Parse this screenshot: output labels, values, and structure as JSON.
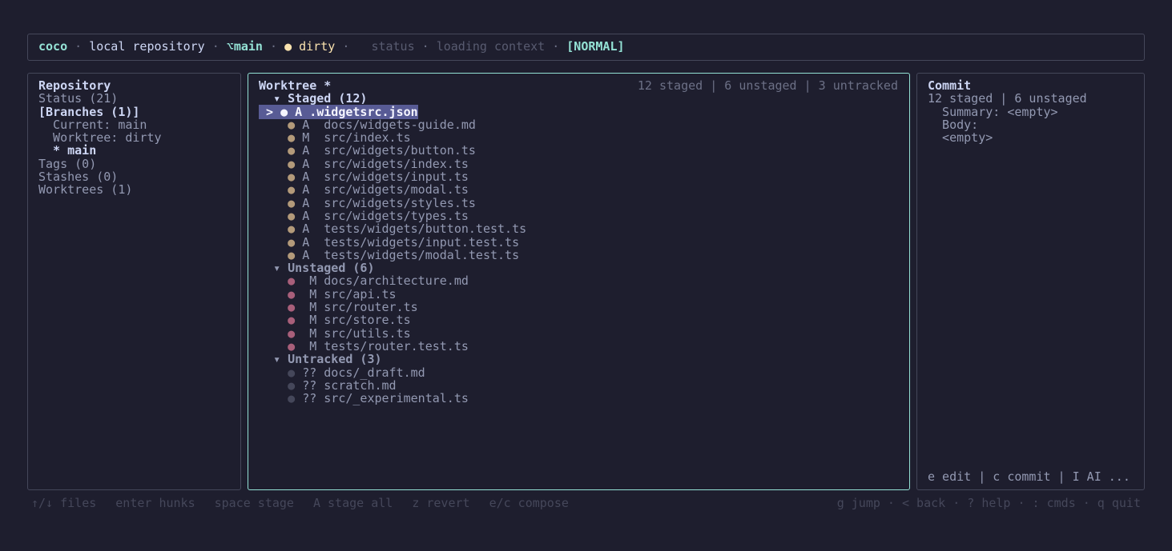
{
  "topbar": {
    "app": "coco",
    "repo": "local repository",
    "branch_icon": "⌥",
    "branch": "main",
    "dirty_dot": "●",
    "dirty": "dirty",
    "status": "status",
    "loading": "loading context",
    "mode": "[NORMAL]",
    "sep": "·"
  },
  "repository": {
    "title": "Repository",
    "items": [
      {
        "label": "Status (21)"
      },
      {
        "label": "[Branches (1)]"
      },
      {
        "label": "  Current: main"
      },
      {
        "label": "  Worktree: dirty"
      },
      {
        "label": "  * main"
      },
      {
        "label": "Tags (0)"
      },
      {
        "label": "Stashes (0)"
      },
      {
        "label": "Worktrees (1)"
      }
    ]
  },
  "worktree": {
    "title": "Worktree *",
    "stats": "12 staged | 6 unstaged | 3 untracked",
    "cursor": ">",
    "staged_header": "▾ Staged (12)",
    "unstaged_header": "▾ Unstaged (6)",
    "untracked_header": "▾ Untracked (3)",
    "dot": "●",
    "staged": [
      {
        "status": "A",
        "path": " .widgetsrc.json"
      },
      {
        "status": "A",
        "path": "docs/widgets-guide.md"
      },
      {
        "status": "M",
        "path": "src/index.ts"
      },
      {
        "status": "A",
        "path": "src/widgets/button.ts"
      },
      {
        "status": "A",
        "path": "src/widgets/index.ts"
      },
      {
        "status": "A",
        "path": "src/widgets/input.ts"
      },
      {
        "status": "A",
        "path": "src/widgets/modal.ts"
      },
      {
        "status": "A",
        "path": "src/widgets/styles.ts"
      },
      {
        "status": "A",
        "path": "src/widgets/types.ts"
      },
      {
        "status": "A",
        "path": "tests/widgets/button.test.ts"
      },
      {
        "status": "A",
        "path": "tests/widgets/input.test.ts"
      },
      {
        "status": "A",
        "path": "tests/widgets/modal.test.ts"
      }
    ],
    "unstaged": [
      {
        "status": "M",
        "path": "docs/architecture.md"
      },
      {
        "status": "M",
        "path": "src/api.ts"
      },
      {
        "status": "M",
        "path": "src/router.ts"
      },
      {
        "status": "M",
        "path": "src/store.ts"
      },
      {
        "status": "M",
        "path": "src/utils.ts"
      },
      {
        "status": "M",
        "path": "tests/router.test.ts"
      }
    ],
    "untracked": [
      {
        "status": "??",
        "path": "docs/_draft.md"
      },
      {
        "status": "??",
        "path": "scratch.md"
      },
      {
        "status": "??",
        "path": "src/_experimental.ts"
      }
    ]
  },
  "commit": {
    "title": "Commit",
    "stats": "12 staged | 6 unstaged",
    "summary": "  Summary: <empty>",
    "body": "  Body:",
    "body_value": "  <empty>",
    "footer": "e edit | c commit | I AI ..."
  },
  "hints": {
    "left": [
      "↑/↓ files",
      "enter hunks",
      "space stage",
      "A stage all",
      "z revert",
      "e/c compose"
    ],
    "right": "g jump · < back · ? help · : cmds · q quit"
  },
  "colors": {
    "background": "#1e1e2e",
    "accent": "#94e2d5",
    "dirty": "#f9e2af",
    "selection": "#585b95"
  }
}
